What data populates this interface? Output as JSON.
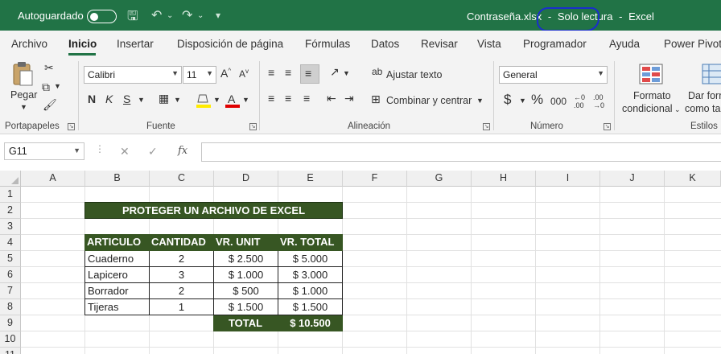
{
  "titlebar": {
    "autosave_label": "Autoguardado",
    "filename": "Contraseña.xlsx",
    "dash1": "-",
    "readonly": "Solo lectura",
    "dash2": "-",
    "app": "Excel"
  },
  "tabs": [
    "Archivo",
    "Inicio",
    "Insertar",
    "Disposición de página",
    "Fórmulas",
    "Datos",
    "Revisar",
    "Vista",
    "Programador",
    "Ayuda",
    "Power Pivot"
  ],
  "ribbon": {
    "clipboard": {
      "paste_label": "Pegar",
      "group_label": "Portapapeles"
    },
    "font": {
      "name": "Calibri",
      "size": "11",
      "bold": "N",
      "italic": "K",
      "underline": "S",
      "group_label": "Fuente"
    },
    "alignment": {
      "wrap_label": "Ajustar texto",
      "merge_label": "Combinar y centrar",
      "group_label": "Alineación"
    },
    "number": {
      "format": "General",
      "currency": "$",
      "percent": "%",
      "thousands": "000",
      "group_label": "Número"
    },
    "styles": {
      "conditional_line1": "Formato",
      "conditional_line2": "condicional",
      "table_line1": "Dar form",
      "table_line2": "como ta",
      "group_label": "Estilos"
    }
  },
  "formula_bar": {
    "name_box": "G11",
    "fx": "fx",
    "value": ""
  },
  "grid": {
    "columns": [
      "A",
      "B",
      "C",
      "D",
      "E",
      "F",
      "G",
      "H",
      "I",
      "J",
      "K"
    ],
    "rows": [
      "1",
      "2",
      "3",
      "4",
      "5",
      "6",
      "7",
      "8",
      "9",
      "10",
      "11"
    ]
  },
  "sheet": {
    "title": "PROTEGER UN ARCHIVO DE EXCEL",
    "headers": [
      "ARTICULO",
      "CANTIDAD",
      "VR. UNIT",
      "VR. TOTAL"
    ],
    "items": [
      {
        "articulo": "Cuaderno",
        "cantidad": "2",
        "unit": "2.500",
        "total": "5.000"
      },
      {
        "articulo": "Lapicero",
        "cantidad": "3",
        "unit": "1.000",
        "total": "3.000"
      },
      {
        "articulo": "Borrador",
        "cantidad": "2",
        "unit": "500",
        "total": "1.000"
      },
      {
        "articulo": "Tijeras",
        "cantidad": "1",
        "unit": "1.500",
        "total": "1.500"
      }
    ],
    "currency_symbol": "$",
    "total_label": "TOTAL",
    "total_value": "10.500"
  }
}
